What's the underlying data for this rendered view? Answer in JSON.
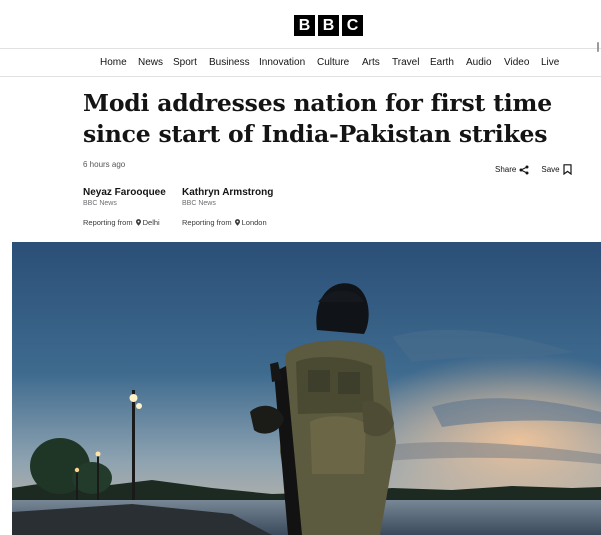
{
  "logo": {
    "letters": [
      "B",
      "B",
      "C"
    ]
  },
  "nav": {
    "items": [
      "Home",
      "News",
      "Sport",
      "Business",
      "Innovation",
      "Culture",
      "Arts",
      "Travel",
      "Earth",
      "Audio",
      "Video",
      "Live"
    ]
  },
  "article": {
    "headline": "Modi addresses nation for first time since start of India-Pakistan strikes",
    "timestamp": "6 hours ago",
    "share_label": "Share",
    "save_label": "Save",
    "authors": [
      {
        "name": "Neyaz Farooquee",
        "org": "BBC News",
        "reporting_prefix": "Reporting from",
        "location": "Delhi"
      },
      {
        "name": "Kathryn Armstrong",
        "org": "BBC News",
        "reporting_prefix": "Reporting from",
        "location": "London"
      }
    ]
  },
  "colors": {
    "brand": "#000000",
    "text": "#141414",
    "divider": "#e2e2e2"
  },
  "icons": {
    "share": "share-icon",
    "save": "bookmark-icon",
    "location": "location-pin-icon"
  }
}
